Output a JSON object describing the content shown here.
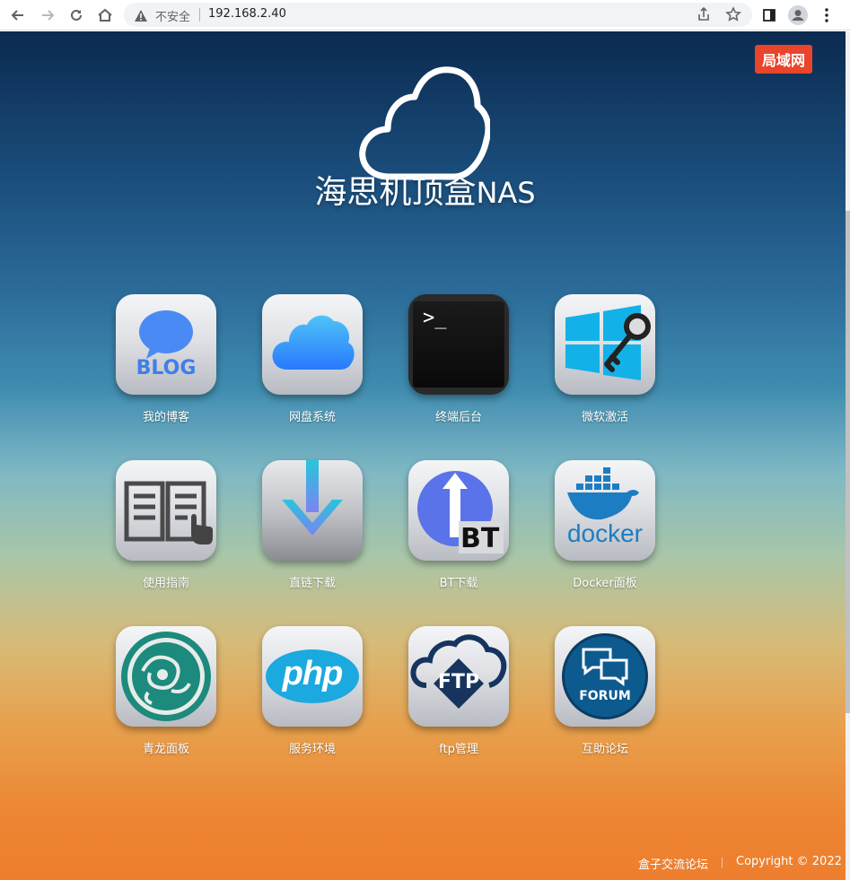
{
  "browser": {
    "security_label": "不安全",
    "url": "192.168.2.40"
  },
  "page": {
    "badge": "局域网",
    "title_cn": "海思机顶盒",
    "title_en": "NAS",
    "apps": [
      {
        "label": "我的博客",
        "icon": "blog-icon"
      },
      {
        "label": "网盘系统",
        "icon": "icloud-icon"
      },
      {
        "label": "终端后台",
        "icon": "terminal-icon"
      },
      {
        "label": "微软激活",
        "icon": "windows-key-icon"
      },
      {
        "label": "使用指南",
        "icon": "book-icon"
      },
      {
        "label": "直链下载",
        "icon": "download-arrow-icon"
      },
      {
        "label": "BT下载",
        "icon": "bt-icon",
        "text": "BT"
      },
      {
        "label": "Docker面板",
        "icon": "docker-icon",
        "text": "docker"
      },
      {
        "label": "青龙面板",
        "icon": "dragon-icon"
      },
      {
        "label": "服务环境",
        "icon": "php-icon",
        "text": "php"
      },
      {
        "label": "ftp管理",
        "icon": "ftp-icon",
        "text": "FTP"
      },
      {
        "label": "互助论坛",
        "icon": "forum-icon",
        "text": "FORUM"
      }
    ],
    "icon_text": {
      "blog": "BLOG",
      "terminal": ">_"
    },
    "footer": {
      "link": "盒子交流论坛",
      "copyright": "Copyright © 2022"
    }
  },
  "colors": {
    "badge": "#e8452a",
    "gradient_top": "#0b2a50",
    "gradient_bottom": "#ee7e2d"
  }
}
